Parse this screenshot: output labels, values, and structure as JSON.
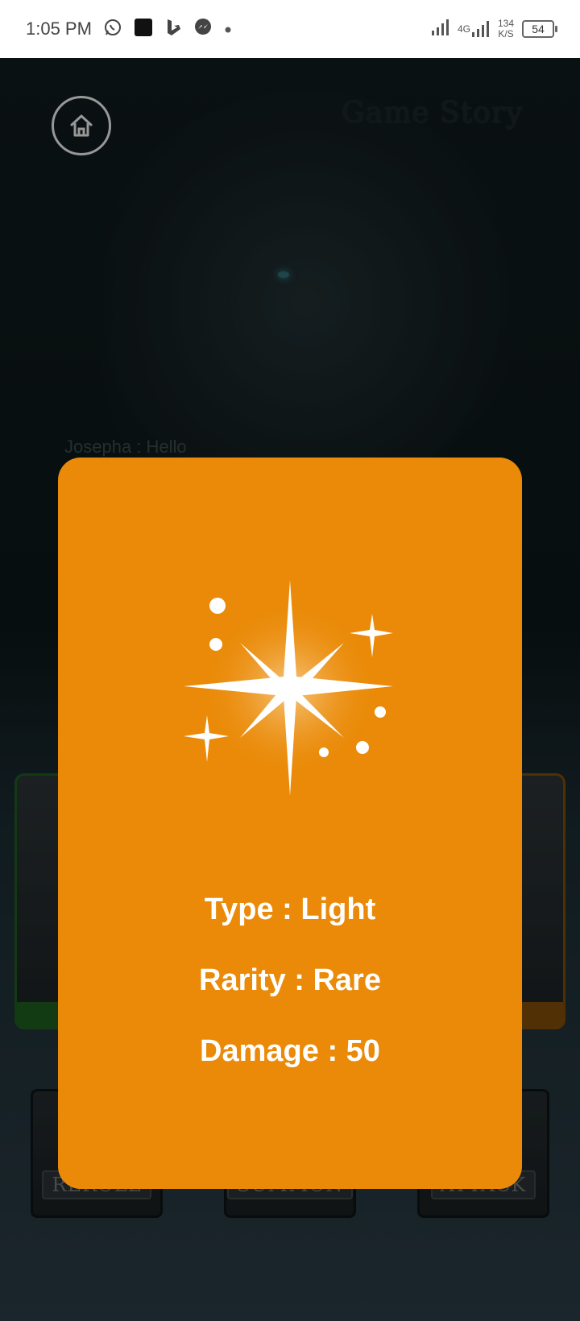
{
  "status_bar": {
    "time": "1:05 PM",
    "net_speed_value": "134",
    "net_speed_unit": "K/S",
    "battery": "54",
    "network": "4G"
  },
  "background": {
    "title": "Game Story",
    "chat_line": "Josepha : Hello",
    "buttons": {
      "reroll": "REROLL",
      "summon": "SUMMON",
      "attack": "ATTACK"
    }
  },
  "card": {
    "type_line": "Type : Light",
    "rarity_line": "Rarity : Rare",
    "damage_line": "Damage : 50",
    "icon": "sparkle-icon",
    "color": "#ea8a08"
  }
}
